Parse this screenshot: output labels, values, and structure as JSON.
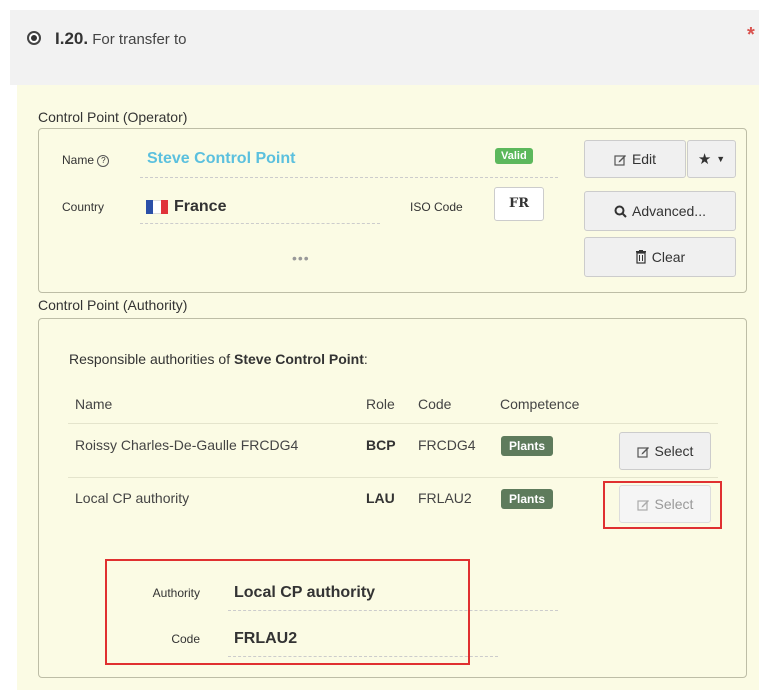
{
  "section": {
    "number": "I.20.",
    "title": "For transfer to",
    "required_mark": "*"
  },
  "operator": {
    "legend": "Control Point (Operator)",
    "name_label": "Name",
    "name_value": "Steve Control Point",
    "status_badge": "Valid",
    "country_label": "Country",
    "country_value": "France",
    "iso_label": "ISO Code",
    "iso_value": "FR",
    "more": "•••",
    "buttons": {
      "edit": "Edit",
      "advanced": "Advanced...",
      "clear": "Clear"
    }
  },
  "authority": {
    "legend": "Control Point (Authority)",
    "responsible_prefix": "Responsible authorities of ",
    "responsible_name": "Steve Control Point",
    "responsible_suffix": ":",
    "columns": [
      "Name",
      "Role",
      "Code",
      "Competence"
    ],
    "rows": [
      {
        "name": "Roissy Charles-De-Gaulle FRCDG4",
        "role": "BCP",
        "code": "FRCDG4",
        "competence": "Plants",
        "action": "Select"
      },
      {
        "name": "Local CP authority",
        "role": "LAU",
        "code": "FRLAU2",
        "competence": "Plants",
        "action": "Select"
      }
    ],
    "detail": {
      "authority_label": "Authority",
      "authority_value": "Local CP authority",
      "code_label": "Code",
      "code_value": "FRLAU2"
    }
  },
  "colors": {
    "accent": "#5bc0de",
    "badge_green": "#5cb85c",
    "plants_badge": "#5e7b5c",
    "highlight_red": "#e03030",
    "panel_bg": "#fbfbe4"
  }
}
